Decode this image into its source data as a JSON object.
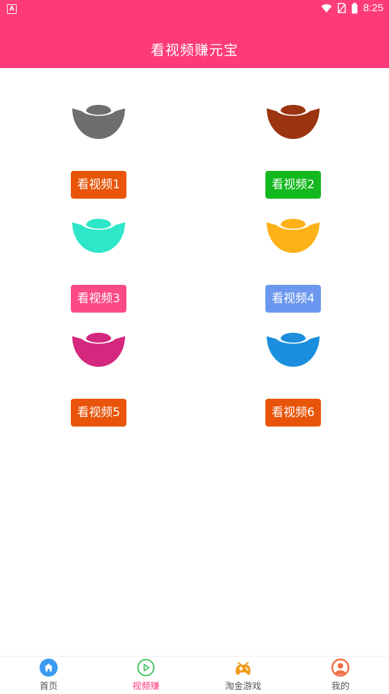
{
  "status_bar": {
    "time": "8:25",
    "left_icon_label": "A"
  },
  "header": {
    "title": "看视频赚元宝"
  },
  "colors": {
    "header_bg": "#fe3b79",
    "active_tab": "#fe3b79"
  },
  "grid_items": [
    {
      "label": "看视频1",
      "ingot_color": "#6e6e6e",
      "button_color": "#e8550a"
    },
    {
      "label": "看视频2",
      "ingot_color": "#9b3410",
      "button_color": "#12b81d"
    },
    {
      "label": "看视频3",
      "ingot_color": "#2ee6c8",
      "button_color": "#fc4a86"
    },
    {
      "label": "看视频4",
      "ingot_color": "#fdb219",
      "button_color": "#6b97ee"
    },
    {
      "label": "看视频5",
      "ingot_color": "#d4277e",
      "button_color": "#e8550a"
    },
    {
      "label": "看视频6",
      "ingot_color": "#1b8fdd",
      "button_color": "#e8550a"
    }
  ],
  "tabs": [
    {
      "label": "首页",
      "icon": "home-icon",
      "active": false
    },
    {
      "label": "视频赚",
      "icon": "play-circle-icon",
      "active": true
    },
    {
      "label": "淘金游戏",
      "icon": "gamepad-icon",
      "active": false
    },
    {
      "label": "我的",
      "icon": "user-avatar-icon",
      "active": false
    }
  ]
}
